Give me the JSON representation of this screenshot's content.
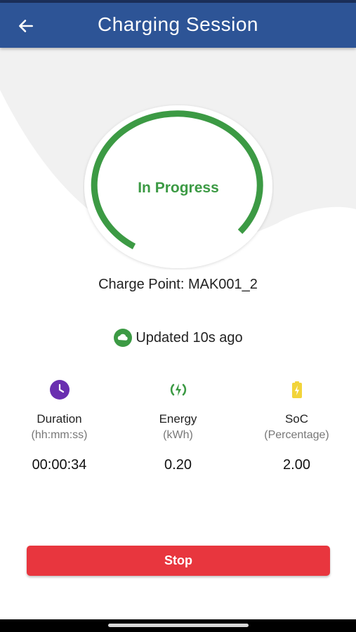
{
  "header": {
    "title": "Charging Session"
  },
  "session": {
    "status": "In Progress",
    "charge_point": "Charge Point: MAK001_2",
    "updated": "Updated 10s ago"
  },
  "metrics": [
    {
      "label": "Duration",
      "unit": "(hh:mm:ss)",
      "value": "00:00:34",
      "icon": "clock-icon",
      "color": "#6a2fb0"
    },
    {
      "label": "Energy",
      "unit": "(kWh)",
      "value": "0.20",
      "icon": "energy-icon",
      "color": "#3c9a44"
    },
    {
      "label": "SoC",
      "unit": "(Percentage)",
      "value": "2.00",
      "icon": "battery-icon",
      "color": "#f2d43a"
    }
  ],
  "actions": {
    "stop_label": "Stop"
  },
  "colors": {
    "app_bar": "#2d5496",
    "accent_green": "#3c9a44",
    "stop_red": "#e8363e"
  }
}
